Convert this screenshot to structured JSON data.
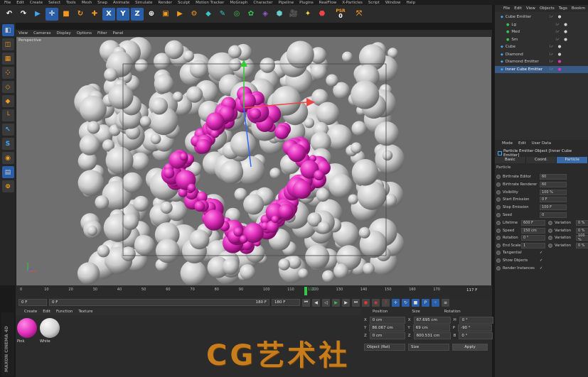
{
  "menubar": [
    "File",
    "Edit",
    "Create",
    "Select",
    "Tools",
    "Mesh",
    "Snap",
    "Animate",
    "Simulate",
    "Render",
    "Sculpt",
    "Motion Tracker",
    "MoGraph",
    "Character",
    "Pipeline",
    "Plugins",
    "RealFlow",
    "X-Particles",
    "Script",
    "Window",
    "Help"
  ],
  "toolbar": {
    "axes": [
      "X",
      "Y",
      "Z"
    ],
    "psr_label": "PSR",
    "psr_value": "0"
  },
  "viewport": {
    "menu": [
      "View",
      "Cameras",
      "Display",
      "Options",
      "Filter",
      "Panel"
    ],
    "label": "Perspective"
  },
  "timeline": {
    "ticks": [
      "0",
      "10",
      "20",
      "30",
      "40",
      "50",
      "60",
      "70",
      "80",
      "90",
      "100",
      "110",
      "120",
      "130",
      "140",
      "150",
      "160",
      "170"
    ],
    "current_frame": "117",
    "end_display": "117 F"
  },
  "transport": {
    "start": "0 F",
    "current": "0 F",
    "range_end": "180 F",
    "end": "180 F"
  },
  "material": {
    "menu": [
      "Create",
      "Edit",
      "Function",
      "Texture"
    ],
    "items": [
      {
        "name": "Pink",
        "color": "#e830b8"
      },
      {
        "name": "White",
        "color": "#d8d8d8"
      }
    ]
  },
  "coordinates": {
    "headers": [
      "Position",
      "Size",
      "Rotation"
    ],
    "rows": [
      {
        "axis": "X",
        "pos": "0 cm",
        "size_axis": "X",
        "size": "67.695 cm",
        "rot_axis": "H",
        "rot": "0 °"
      },
      {
        "axis": "Y",
        "pos": "86.067 cm",
        "size_axis": "Y",
        "size": "69 cm",
        "rot_axis": "P",
        "rot": "-90 °"
      },
      {
        "axis": "Z",
        "pos": "0 cm",
        "size_axis": "Z",
        "size": "600.531 cm",
        "rot_axis": "B",
        "rot": "0 °"
      }
    ],
    "mode_object": "Object (Rel)",
    "mode_size": "Size",
    "apply": "Apply"
  },
  "objects": {
    "menu": [
      "File",
      "Edit",
      "View",
      "Objects",
      "Tags",
      "Bookm"
    ],
    "items": [
      {
        "name": "Cube Emitter",
        "indent": 0,
        "selected": false
      },
      {
        "name": "Lg",
        "indent": 1,
        "selected": false
      },
      {
        "name": "Med",
        "indent": 1,
        "selected": false
      },
      {
        "name": "Sm",
        "indent": 1,
        "selected": false
      },
      {
        "name": "Cube",
        "indent": 0,
        "selected": false
      },
      {
        "name": "Diamond",
        "indent": 0,
        "selected": false
      },
      {
        "name": "Diamond Emitter",
        "indent": 0,
        "selected": false
      },
      {
        "name": "Inner Cube Emitter",
        "indent": 0,
        "selected": true
      }
    ]
  },
  "attributes": {
    "menu": [
      "Mode",
      "Edit",
      "User Data"
    ],
    "title": "Particle Emitter Object [Inner Cube Emitter]",
    "tabs": [
      "Basic",
      "Coord.",
      "Particle"
    ],
    "active_tab": "Particle",
    "section": "Particle",
    "fields": [
      {
        "label": "Birthrate Editor",
        "value": "60"
      },
      {
        "label": "Birthrate Renderer",
        "value": "60"
      },
      {
        "label": "Visibility",
        "value": "100 %"
      },
      {
        "label": "Start Emission",
        "value": "0 F"
      },
      {
        "label": "Stop Emission",
        "value": "100 F"
      },
      {
        "label": "Seed",
        "value": "0"
      }
    ],
    "pairs": [
      {
        "label": "Lifetime",
        "value": "600 F",
        "var_label": "Variation",
        "var": "0 %"
      },
      {
        "label": "Speed",
        "value": "150 cm",
        "var_label": "Variation",
        "var": "0 %"
      },
      {
        "label": "Rotation",
        "value": "0 °",
        "var_label": "Variation",
        "var": "100 %"
      },
      {
        "label": "End Scale",
        "value": "1",
        "var_label": "Variation",
        "var": "0 %"
      }
    ],
    "checks": [
      {
        "label": "Tangential"
      },
      {
        "label": "Show Objects"
      },
      {
        "label": "Render Instances"
      }
    ]
  },
  "watermark": "CG艺术社",
  "brand": "MAXON CINEMA 4D"
}
